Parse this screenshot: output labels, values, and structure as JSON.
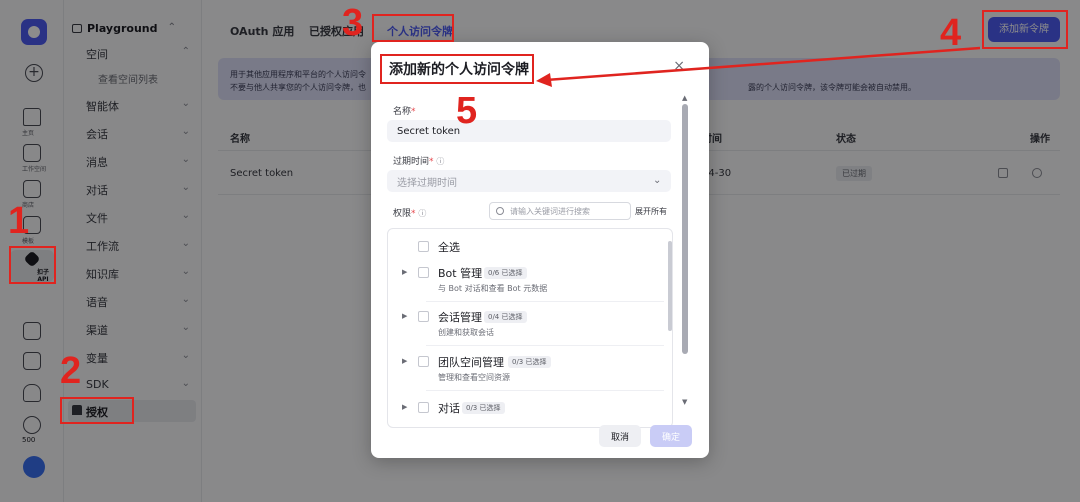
{
  "rail": {
    "items": [
      {
        "label": "主页",
        "icon": "home-icon"
      },
      {
        "label": "工作空间",
        "icon": "terminal-icon"
      },
      {
        "label": "商店",
        "icon": "store-icon"
      },
      {
        "label": "模板",
        "icon": "template-icon"
      },
      {
        "label": "扣子 API",
        "icon": "api-icon"
      }
    ],
    "bottom_count": "500"
  },
  "sidebar": {
    "head": "Playground",
    "space": "空间",
    "space_sub": "查看空间列表",
    "items": [
      "智能体",
      "会话",
      "消息",
      "对话",
      "文件",
      "工作流",
      "知识库",
      "语音",
      "渠道",
      "变量",
      "SDK"
    ],
    "auth": "授权"
  },
  "tabs": [
    "OAuth 应用",
    "已授权应用",
    "个人访问令牌"
  ],
  "add_token_button": "添加新令牌",
  "info": {
    "line1": "用于其他应用程序和平台的个人访问令",
    "line2": "不要与他人共享您的个人访问令牌，也",
    "line2_right": "露的个人访问令牌，该令牌可能会被自动禁用。"
  },
  "table": {
    "headers": {
      "name": "名称",
      "time": "时间",
      "status": "状态",
      "action": "操作"
    },
    "row": {
      "name": "Secret token",
      "time": "04-30",
      "status": "已过期"
    }
  },
  "modal": {
    "title": "添加新的个人访问令牌",
    "close": "×",
    "name_label": "名称",
    "name_value": "Secret token",
    "expire_label": "过期时间",
    "expire_placeholder": "选择过期时间",
    "perm_label": "权限",
    "perm_search_placeholder": "请输入关键词进行搜索",
    "expand_all": "展开所有",
    "select_all": "全选",
    "permissions": [
      {
        "name": "Bot 管理",
        "count": "0/6 已选择",
        "desc": "与 Bot 对话和查看 Bot 元数据"
      },
      {
        "name": "会话管理",
        "count": "0/4 已选择",
        "desc": "创建和获取会话"
      },
      {
        "name": "团队空间管理",
        "count": "0/3 已选择",
        "desc": "管理和查看空间资源"
      },
      {
        "name": "对话",
        "count": "0/3 已选择",
        "desc": ""
      }
    ],
    "cancel": "取消",
    "confirm": "确定"
  },
  "annotations": {
    "n1": "1",
    "n2": "2",
    "n3": "3",
    "n4": "4",
    "n5": "5"
  },
  "colors": {
    "accent": "#4e5bf2",
    "annotation": "#e0241f"
  }
}
